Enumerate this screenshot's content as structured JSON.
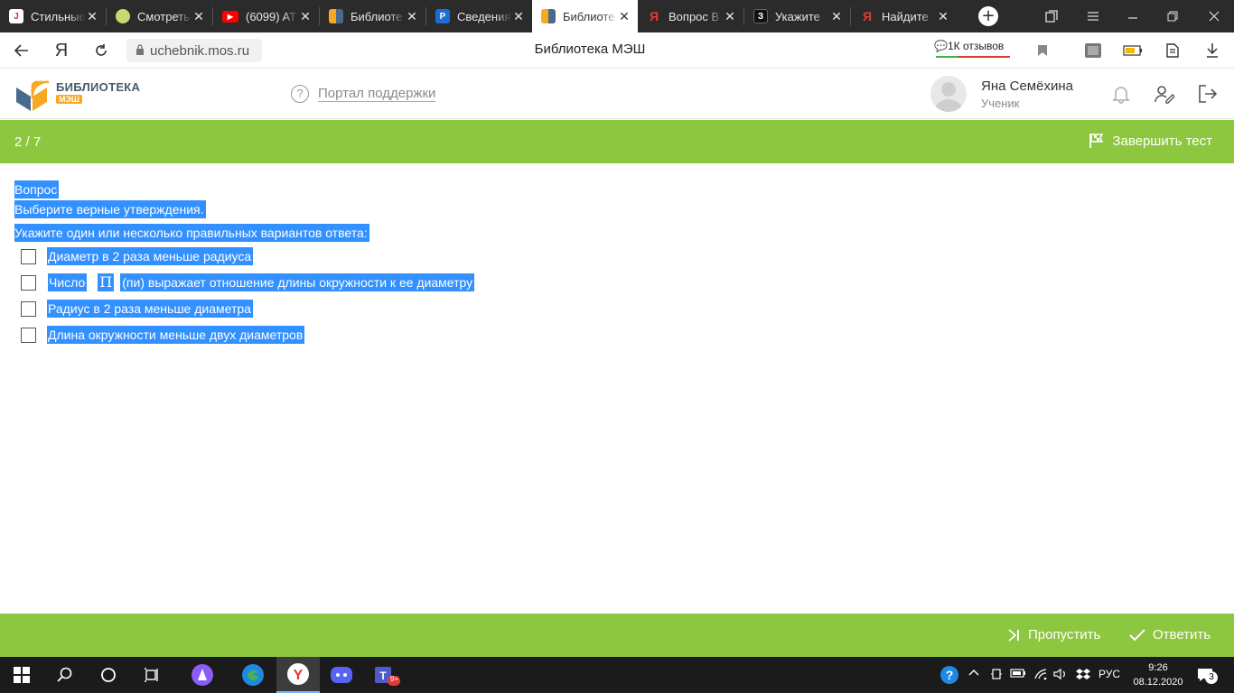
{
  "browser": {
    "tabs": [
      {
        "title": "Стильные",
        "favicon_color": "#ffffff",
        "favicon_letter": "J",
        "active": false
      },
      {
        "title": "Смотреть",
        "favicon_color": "#c8d96f",
        "favicon_letter": "",
        "active": false
      },
      {
        "title": "(6099) AT",
        "favicon_color": "#ff0000",
        "favicon_letter": "▶",
        "active": false
      },
      {
        "title": "Библиоте",
        "favicon_color": "#f7a823",
        "favicon_letter": "",
        "active": false
      },
      {
        "title": "Сведения",
        "favicon_color": "#1c6fd1",
        "favicon_letter": "P",
        "active": false
      },
      {
        "title": "Библиоте",
        "favicon_color": "#f7a823",
        "favicon_letter": "",
        "active": true
      },
      {
        "title": "Вопрос В",
        "favicon_color": "#e53935",
        "favicon_letter": "Я",
        "active": false
      },
      {
        "title": "Укажите",
        "favicon_color": "#111111",
        "favicon_letter": "З",
        "active": false
      },
      {
        "title": "Найдите",
        "favicon_color": "#e53935",
        "favicon_letter": "Я",
        "active": false
      }
    ],
    "url": "uchebnik.mos.ru",
    "page_title": "Библиотека МЭШ",
    "reviews": "1К отзывов"
  },
  "header": {
    "logo_title": "БИБЛИОТЕКА",
    "logo_sub": "МЭШ",
    "support": "Портал поддержки",
    "user_name": "Яна Семёхина",
    "user_role": "Ученик"
  },
  "test_bar": {
    "counter": "2 / 7",
    "finish": "Завершить тест"
  },
  "question": {
    "label": "Вопрос",
    "text": "Выберите верные утверждения.",
    "hint": "Укажите один или несколько правильных вариантов ответа:",
    "options": [
      {
        "text": "Диаметр в 2 раза меньше радиуса"
      },
      {
        "text_before": "Число",
        "symbol": "П",
        "text_after": "(пи) выражает отношение длины окружности к  ее диаметру"
      },
      {
        "text": "Радиус в 2 раза меньше диаметра"
      },
      {
        "text": "Длина окружности меньше двух диаметров"
      }
    ]
  },
  "bottom_bar": {
    "skip": "Пропустить",
    "answer": "Ответить"
  },
  "taskbar": {
    "lang": "РУС",
    "time": "9:26",
    "date": "08.12.2020",
    "notifications": "3",
    "teams_badge": "9+"
  },
  "colors": {
    "accent_green": "#8dc63f",
    "selection_blue": "#3390ff",
    "logo_orange": "#f7a823"
  }
}
